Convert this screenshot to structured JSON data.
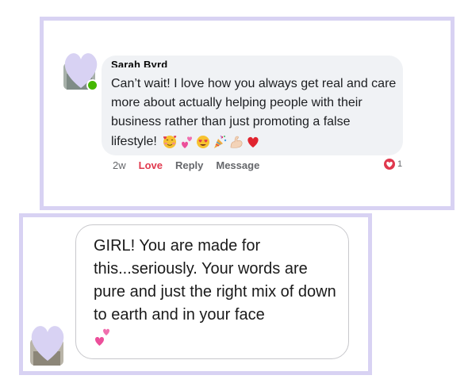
{
  "comment1": {
    "author": "Sarah Byrd",
    "text": "Can’t wait! I love how you always get real and care more about actually helping people with their business rather than just promoting a false",
    "last_line": "lifestyle!",
    "emojis": [
      "smiling-face-with-hearts",
      "two-hearts",
      "heart-eyes",
      "party-popper",
      "flexed-biceps",
      "red-heart"
    ],
    "time": "2w",
    "love_label": "Love",
    "reply_label": "Reply",
    "message_label": "Message",
    "reaction_count": "1",
    "online": true
  },
  "comment2": {
    "text": "GIRL! You are made for this...seriously. Your words are pure and just the right mix of down to earth and in your face",
    "emoji": "two-hearts"
  },
  "colors": {
    "frame": "#d8d2f3",
    "fb_bubble": "#f0f2f5",
    "love": "#e0394e",
    "online": "#44b700",
    "avatar_blur": "#d8d2f3"
  }
}
